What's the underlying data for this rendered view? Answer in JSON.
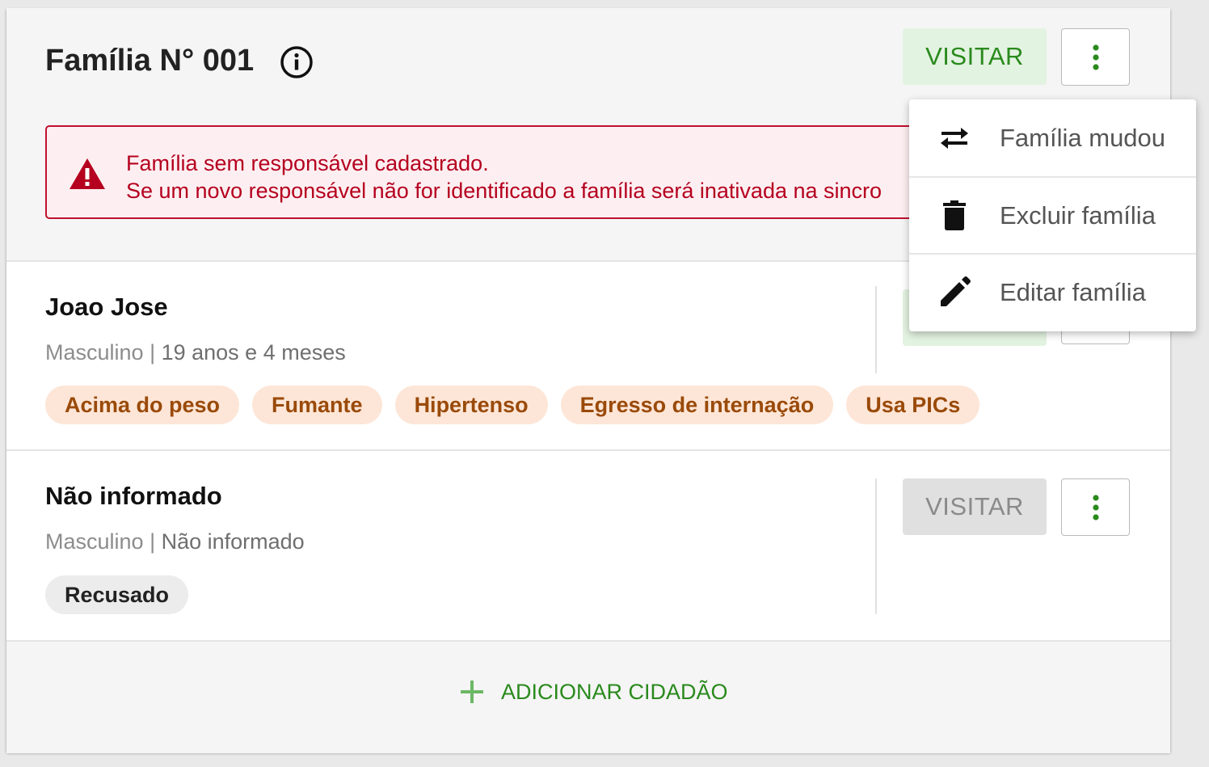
{
  "family": {
    "title": "Família N° 001",
    "visit_label": "VISITAR",
    "alert": {
      "line1": "Família sem responsável cadastrado.",
      "line2": "Se um novo responsável não for identificado a família será inativada na sincro"
    }
  },
  "members": [
    {
      "name": "Joao Jose",
      "sex": "Masculino",
      "separator": " | ",
      "age": "19 anos e 4 meses",
      "tags": [
        "Acima do peso",
        "Fumante",
        "Hipertenso",
        "Egresso de internação",
        "Usa PICs"
      ]
    },
    {
      "name": "Não informado",
      "sex": "Masculino",
      "separator": " | ",
      "age": "Não informado",
      "tags": [
        "Recusado"
      ],
      "visit_label": "VISITAR"
    }
  ],
  "footer": {
    "add_label": "ADICIONAR CIDADÃO",
    "icon": "plus-icon"
  },
  "menu": {
    "items": [
      {
        "label": "Família mudou",
        "icon": "swap-arrows-icon"
      },
      {
        "label": "Excluir família",
        "icon": "trash-icon"
      },
      {
        "label": "Editar família",
        "icon": "pencil-icon"
      }
    ]
  },
  "colors": {
    "accent": "#2a8a1d",
    "alert": "#c0102e",
    "tag_warn_bg": "#fde6d7",
    "tag_warn_text": "#9a4a09"
  }
}
